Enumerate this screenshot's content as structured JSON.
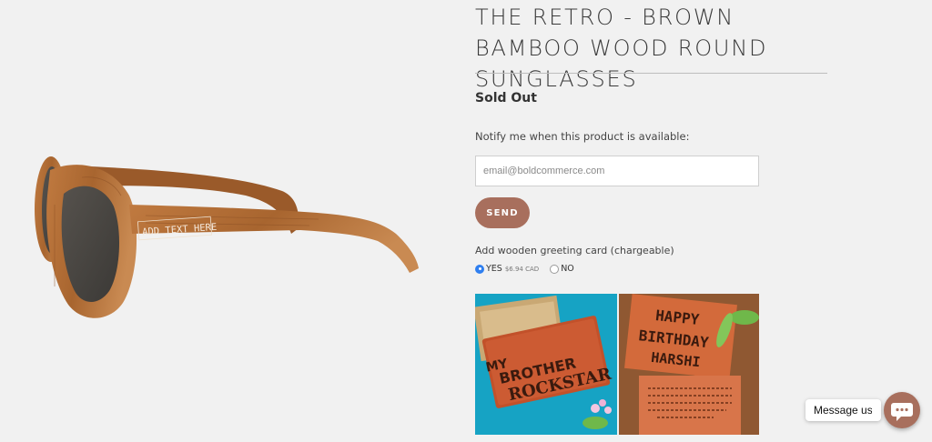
{
  "product": {
    "title": "THE RETRO - BROWN BAMBOO WOOD ROUND SUNGLASSES",
    "image_engraving": "ADD TEXT HERE",
    "stock_status": "Sold Out"
  },
  "notify": {
    "label": "Notify me when this product is available:",
    "email_placeholder": "email@boldcommerce.com",
    "send_label": "SEND"
  },
  "addon": {
    "label": "Add wooden greeting card (chargeable)",
    "options": [
      {
        "label": "YES",
        "price": "$6.94 CAD",
        "selected": true
      },
      {
        "label": "NO",
        "selected": false
      }
    ],
    "card_text": {
      "my": "MY",
      "brother": "BROTHER",
      "rockstar": "ROCKSTAR",
      "happy": "HAPPY",
      "birthday": "BIRTHDAY",
      "name": "HARSHI"
    }
  },
  "chat": {
    "label": "Message us",
    "icon": "chat-bubble-icon"
  },
  "colors": {
    "accent": "#a86f5d",
    "background": "#f1f1f1",
    "radio_selected": "#2f7ff0",
    "wood": "#b26f3c"
  }
}
